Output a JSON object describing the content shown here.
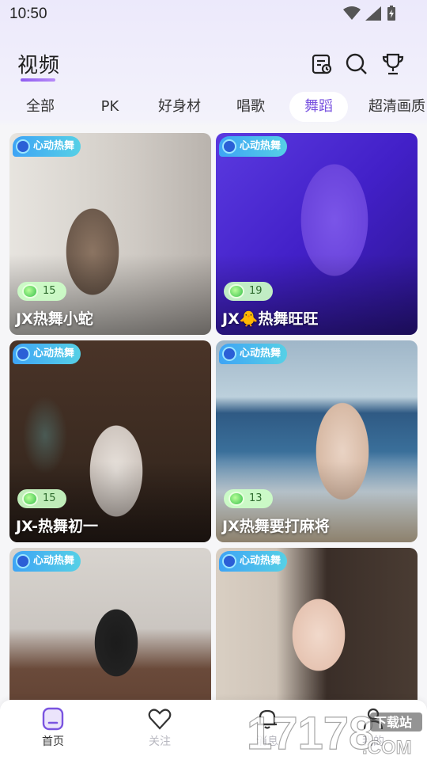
{
  "status": {
    "time": "10:50"
  },
  "header": {
    "title": "视频"
  },
  "tabs": [
    {
      "label": "全部"
    },
    {
      "label": "PK"
    },
    {
      "label": "好身材"
    },
    {
      "label": "唱歌"
    },
    {
      "label": "舞蹈",
      "active": true
    },
    {
      "label": "超清画质"
    }
  ],
  "cards": [
    {
      "badge": "心动热舞",
      "gifts": "15",
      "title": "JX热舞小蛇"
    },
    {
      "badge": "心动热舞",
      "gifts": "19",
      "title": "JX🐥热舞旺旺"
    },
    {
      "badge": "心动热舞",
      "gifts": "15",
      "title": "JX-热舞初一"
    },
    {
      "badge": "心动热舞",
      "gifts": "13",
      "title": "JX热舞要打麻将"
    },
    {
      "badge": "心动热舞",
      "gifts": "",
      "title": ""
    },
    {
      "badge": "心动热舞",
      "gifts": "",
      "title": ""
    }
  ],
  "nav": [
    {
      "label": "首页",
      "icon": "home-icon",
      "active": true
    },
    {
      "label": "关注",
      "icon": "heart-icon"
    },
    {
      "label": "消息",
      "icon": "bell-icon"
    },
    {
      "label": "我的",
      "icon": "user-icon"
    }
  ],
  "watermark": {
    "text": "17178",
    "sub": "下载站",
    "domain": ".COM"
  },
  "colors": {
    "accent": "#8e5bf0",
    "badge": "#3ea4f5",
    "gift": "#cdffc8"
  }
}
